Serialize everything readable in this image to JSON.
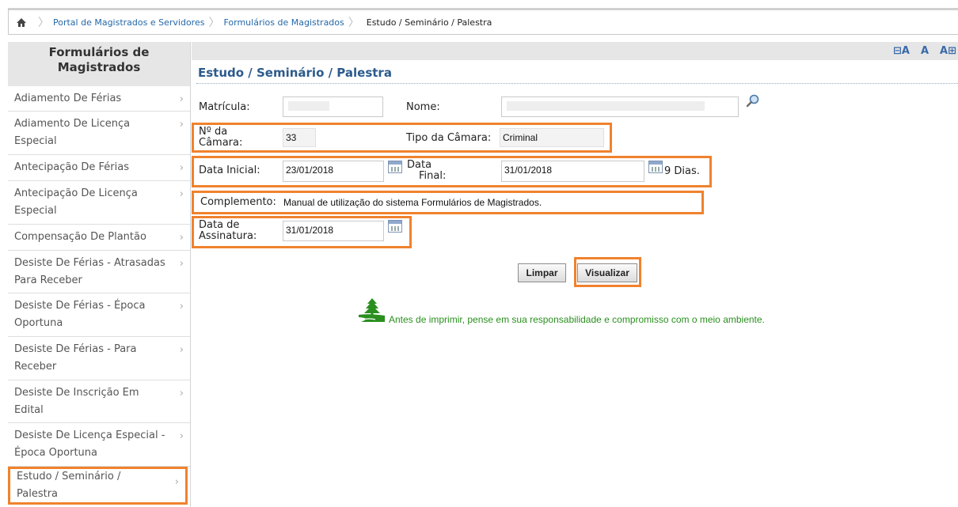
{
  "breadcrumb": {
    "home_icon": "home-icon",
    "items": [
      "Portal de Magistrados e Servidores",
      "Formulários de Magistrados"
    ],
    "current": "Estudo / Seminário / Palestra"
  },
  "sidebar": {
    "title_line1": "Formulários de",
    "title_line2": "Magistrados",
    "items": [
      {
        "label": "Adiamento De Férias"
      },
      {
        "label": "Adiamento De Licença Especial"
      },
      {
        "label": "Antecipação De Férias"
      },
      {
        "label": "Antecipação De Licença Especial"
      },
      {
        "label": "Compensação De Plantão"
      },
      {
        "label": "Desiste De Férias - Atrasadas Para Receber"
      },
      {
        "label": "Desiste De Férias - Época Oportuna"
      },
      {
        "label": "Desiste De Férias - Para Receber"
      },
      {
        "label": "Desiste De Inscrição Em Edital"
      },
      {
        "label": "Desiste De Licença Especial - Época Oportuna"
      },
      {
        "label": "Estudo / Seminário / Palestra"
      }
    ]
  },
  "font_controls": {
    "decrease": "⊟A",
    "normal": "A",
    "increase": "A⊞"
  },
  "page_title": "Estudo / Seminário / Palestra",
  "form": {
    "matricula_label": "Matrícula:",
    "nome_label": "Nome:",
    "camara_num_label_1": "Nº da",
    "camara_num_label_2": "Câmara:",
    "camara_num_value": "33",
    "tipo_camara_label": "Tipo da Câmara:",
    "tipo_camara_value": "Criminal",
    "data_inicial_label": "Data Inicial:",
    "data_inicial_value": "23/01/2018",
    "data_final_label_1": "Data",
    "data_final_label_2": "Final:",
    "data_final_value": "31/01/2018",
    "dias_text": "9 Dias.",
    "complemento_label": "Complemento:",
    "complemento_value": "Manual de utilização do sistema Formulários de Magistrados.",
    "assinatura_label_1": "Data de",
    "assinatura_label_2": "Assinatura:",
    "assinatura_value": "31/01/2018"
  },
  "buttons": {
    "limpar": "Limpar",
    "visualizar": "Visualizar"
  },
  "eco_message": "Antes de imprimir, pense em sua responsabilidade e compromisso com o meio ambiente.",
  "colors": {
    "accent_highlight": "#f0822d",
    "link": "#2468a8",
    "title": "#2c5a8c",
    "eco": "#2a8f1f"
  }
}
